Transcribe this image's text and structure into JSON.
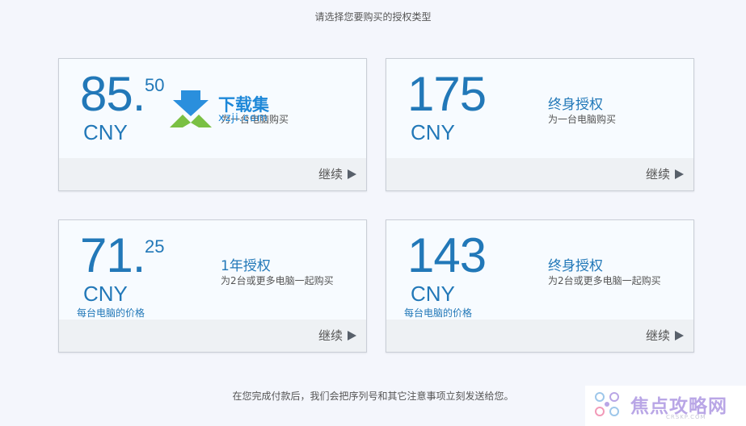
{
  "header": {
    "prompt": "请选择您要购买的授权类型"
  },
  "cards": [
    {
      "price_int": "85.",
      "price_dec": "50",
      "currency": "CNY",
      "per_pc": "",
      "title": "",
      "desc": "为一台电脑购买",
      "continue_label": "继续"
    },
    {
      "price_int": "175",
      "price_dec": "",
      "currency": "CNY",
      "per_pc": "",
      "title": "终身授权",
      "desc": "为一台电脑购买",
      "continue_label": "继续"
    },
    {
      "price_int": "71.",
      "price_dec": "25",
      "currency": "CNY",
      "per_pc": "每台电脑的价格",
      "title": "1年授权",
      "desc": "为2台或更多电脑一起购买",
      "continue_label": "继续"
    },
    {
      "price_int": "143",
      "price_dec": "",
      "currency": "CNY",
      "per_pc": "每台电脑的价格",
      "title": "终身授权",
      "desc": "为2台或更多电脑一起购买",
      "continue_label": "继续"
    }
  ],
  "footer": {
    "note": "在您完成付款后，我们会把序列号和其它注意事项立刻发送给您。"
  },
  "watermarks": {
    "top_left": {
      "title": "下载集",
      "sub": "xzji.com"
    },
    "bottom_right": {
      "title": "焦点攻略网",
      "sub": "CRSKP.COM"
    }
  },
  "colors": {
    "accent": "#2278b8",
    "background": "#f4f6fc",
    "card": "#f7fbff",
    "card_footer": "#eef1f4"
  }
}
